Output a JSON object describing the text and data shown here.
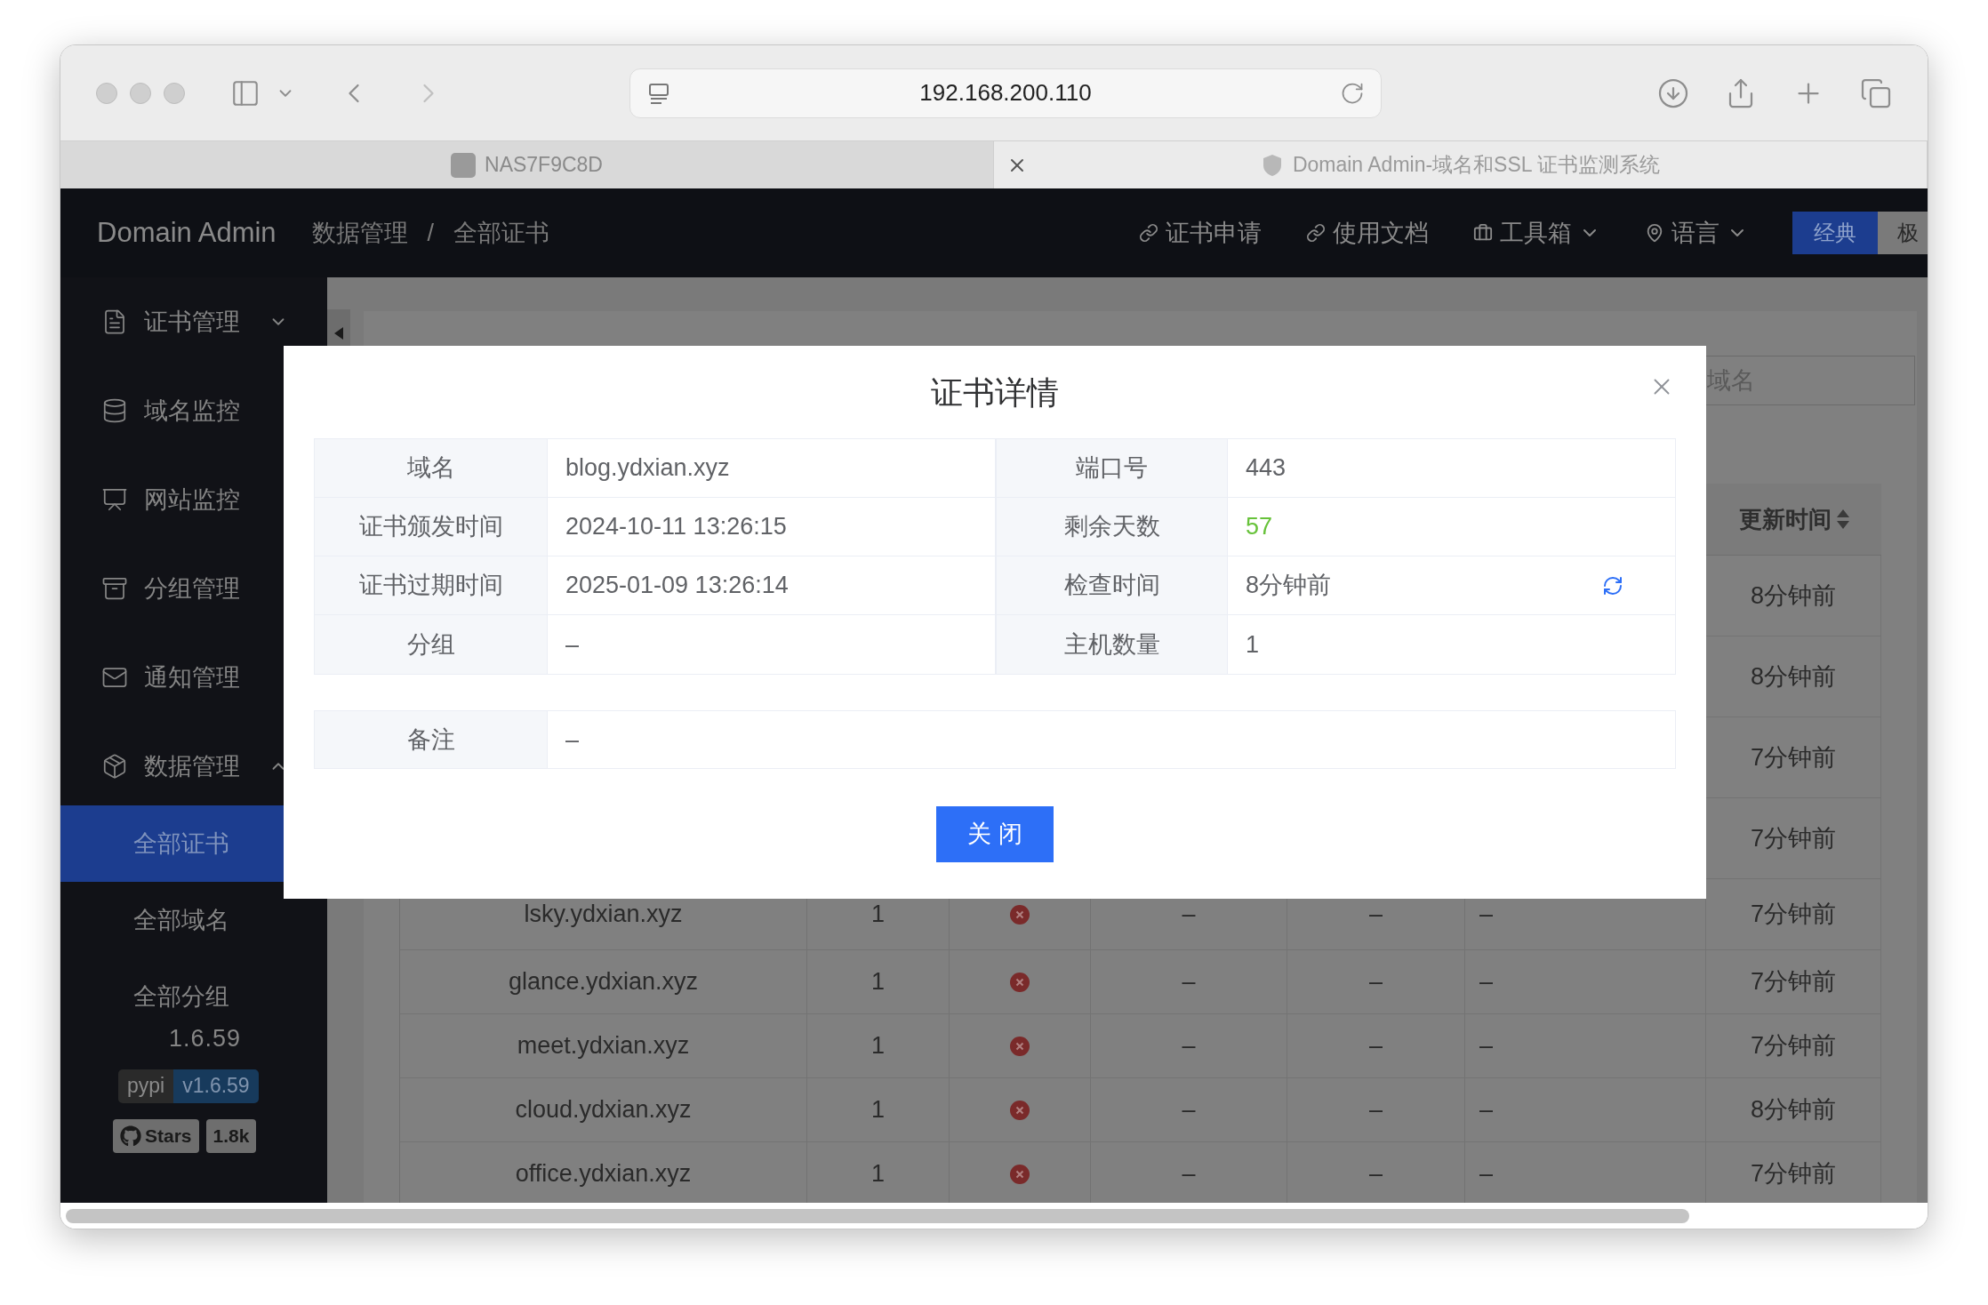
{
  "browser": {
    "url": "192.168.200.110",
    "tabs": [
      {
        "label": "NAS7F9C8D",
        "selected": false
      },
      {
        "label": "Domain Admin-域名和SSL 证书监测系统",
        "selected": true
      }
    ]
  },
  "header": {
    "brand": "Domain Admin",
    "breadcrumb": [
      "数据管理",
      "/",
      "全部证书"
    ],
    "nav": [
      {
        "label": "证书申请",
        "kind": "link"
      },
      {
        "label": "使用文档",
        "kind": "link"
      },
      {
        "label": "工具箱",
        "kind": "toolbox"
      },
      {
        "label": "语言",
        "kind": "language"
      }
    ],
    "theme_buttons": [
      {
        "label": "经典",
        "selected": true
      },
      {
        "label": "极",
        "selected": false
      }
    ]
  },
  "sidebar": {
    "items": [
      {
        "label": "证书管理",
        "selected": false,
        "expanded": false
      },
      {
        "label": "域名监控",
        "selected": false
      },
      {
        "label": "网站监控",
        "selected": false
      },
      {
        "label": "分组管理",
        "selected": false
      },
      {
        "label": "通知管理",
        "selected": false
      },
      {
        "label": "数据管理",
        "selected": false,
        "expanded": true,
        "children": [
          {
            "label": "全部证书",
            "selected": true
          },
          {
            "label": "全部域名",
            "selected": false
          },
          {
            "label": "全部分组",
            "selected": false
          }
        ]
      }
    ],
    "version": "1.6.59",
    "pypi": {
      "label": "pypi",
      "value": "v1.6.59"
    },
    "stars": {
      "label": "Stars",
      "count": "1.8k"
    }
  },
  "content": {
    "filter": {
      "placeholder": "域名"
    },
    "table": {
      "columns": [
        {
          "label": "更新时间"
        }
      ],
      "rows": [
        {
          "updated": "8分钟前"
        },
        {
          "updated": "8分钟前"
        },
        {
          "updated": "7分钟前"
        },
        {
          "updated": "7分钟前"
        },
        {
          "domain": "lsky.ydxian.xyz",
          "count": "1",
          "ok": false,
          "column_4": "–",
          "column_5": "–",
          "column_6": "–",
          "updated": "7分钟前"
        },
        {
          "domain": "glance.ydxian.xyz",
          "count": "1",
          "ok": false,
          "column_4": "–",
          "column_5": "–",
          "column_6": "–",
          "updated": "7分钟前"
        },
        {
          "domain": "meet.ydxian.xyz",
          "count": "1",
          "ok": false,
          "column_4": "–",
          "column_5": "–",
          "column_6": "–",
          "updated": "7分钟前"
        },
        {
          "domain": "cloud.ydxian.xyz",
          "count": "1",
          "ok": false,
          "column_4": "–",
          "column_5": "–",
          "column_6": "–",
          "updated": "8分钟前"
        },
        {
          "domain": "office.ydxian.xyz",
          "count": "1",
          "ok": false,
          "column_4": "–",
          "column_5": "–",
          "column_6": "–",
          "updated": "7分钟前"
        }
      ]
    }
  },
  "modal": {
    "title": "证书详情",
    "fields": [
      {
        "label": "域名",
        "value": "blog.ydxian.xyz"
      },
      {
        "label": "端口号",
        "value": "443"
      },
      {
        "label": "证书颁发时间",
        "value": "2024-10-11 13:26:15"
      },
      {
        "label": "剩余天数",
        "value": "57",
        "color": "#67c23a"
      },
      {
        "label": "证书过期时间",
        "value": "2025-01-09 13:26:14"
      },
      {
        "label": "检查时间",
        "value": "8分钟前",
        "refreshable": true
      },
      {
        "label": "分组",
        "value": "–"
      },
      {
        "label": "主机数量",
        "value": "1"
      }
    ],
    "remark": {
      "label": "备注",
      "value": "–"
    },
    "button": "关 闭"
  }
}
